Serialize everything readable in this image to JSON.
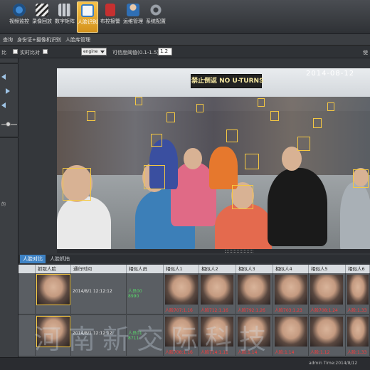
{
  "toolbar": {
    "items": [
      {
        "label": "视频监控",
        "icon": "camera-icon",
        "color": "#3f8bd6"
      },
      {
        "label": "录像回放",
        "icon": "clapper-icon",
        "color": "#7aa6d8"
      },
      {
        "label": "数字矩阵",
        "icon": "matrix-icon",
        "color": "#8a8f96"
      },
      {
        "label": "人脸识别",
        "icon": "face-id-icon",
        "color": "#f4f6f8"
      },
      {
        "label": "布控接警",
        "icon": "alarm-book-icon",
        "color": "#c63030"
      },
      {
        "label": "运维管理",
        "icon": "admin-user-icon",
        "color": "#2f6fb5"
      },
      {
        "label": "系统配置",
        "icon": "gear-icon",
        "color": "#9aa0a8"
      }
    ]
  },
  "subnav": {
    "item1": "查询",
    "item2": "身份证+摄像机识别",
    "item3": "人脸库管理"
  },
  "controls": {
    "left_label": "比",
    "realtime_label": "实时比对",
    "engine_value": "engine",
    "threshold_label": "可信度阈值(0.1-1.5)",
    "threshold_value": "1.2",
    "right_label": "使"
  },
  "left_panel": {
    "bottom_text": "的"
  },
  "video": {
    "sign_text": "禁止倒返 NO U-TURNS",
    "timestamp": "2014-08-12"
  },
  "bottom_tabs": {
    "tab1": "人脸对比",
    "tab2": "人脸抓拍"
  },
  "table": {
    "headers": [
      "抓取人脸",
      "通行时间",
      "相似人员",
      "相似人1",
      "相似人2",
      "相似人3",
      "相似人4",
      "相似人5",
      "相似人6"
    ],
    "rows": [
      {
        "time": "2014/8/1 12:12:12",
        "person": "人员00",
        "person_extra": "8990",
        "sims": [
          "人脸707:1.16",
          "人脸712:1.16",
          "人脸792:1.26",
          "人脸703:1.23",
          "人脸708:1.24",
          "人脸:1.33"
        ]
      },
      {
        "time": "2014/8/1 12:12:12",
        "person": "人员01",
        "person_extra": "8711",
        "sims": [
          "人脸708:1.16",
          "人脸714:1.11",
          "人脸:1.14",
          "人脸:1.14",
          "人脸:1.12",
          "人脸:1.33"
        ]
      }
    ]
  },
  "watermark": "河南新交际科技",
  "status": {
    "user": "admin  Time:2014/8/12"
  }
}
